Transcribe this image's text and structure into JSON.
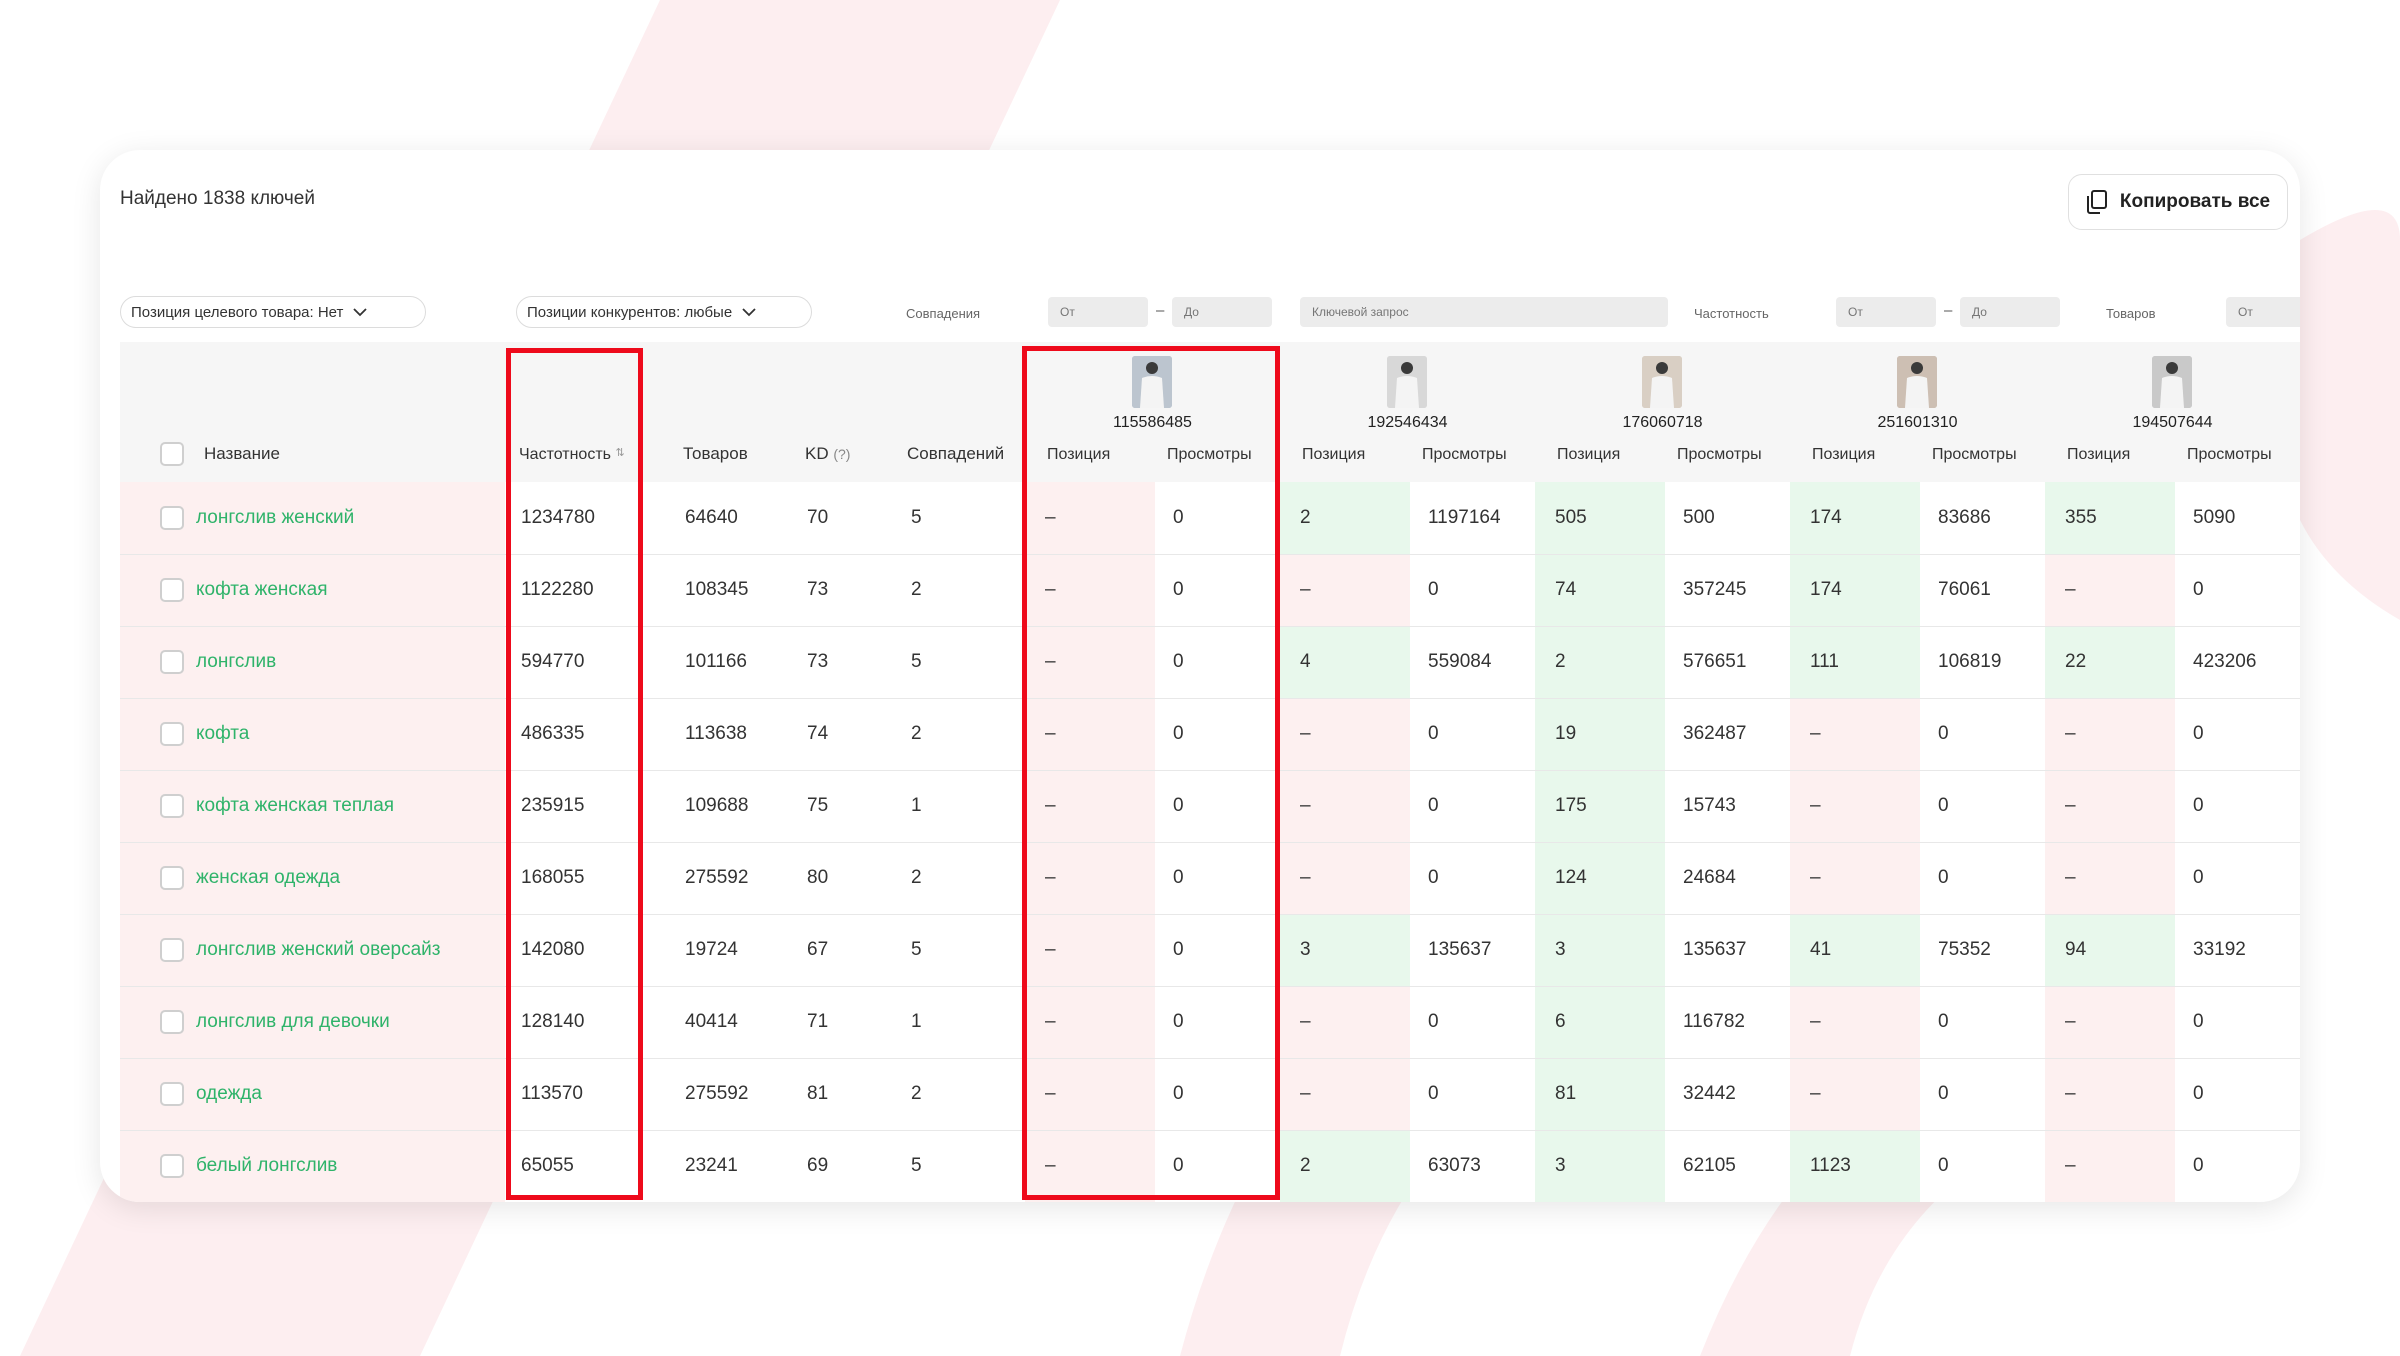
{
  "header": {
    "found_text": "Найдено 1838 ключей",
    "copy_all_label": "Копировать все"
  },
  "filters": {
    "target_position_label": "Позиция целевого товара: Нет",
    "competitor_position_label": "Позиции конкурентов: любые",
    "matches_label": "Совпадения",
    "frequency_label": "Частотность",
    "goods_label": "Товаров",
    "from_placeholder": "От",
    "to_placeholder": "До",
    "dash": "–",
    "keyword_placeholder": "Ключевой запрос"
  },
  "columns": {
    "name": "Название",
    "frequency": "Частотность",
    "goods": "Товаров",
    "kd": "KD",
    "kd_help": "(?)",
    "matches": "Совпадений",
    "position": "Позиция",
    "views": "Просмотры"
  },
  "products": [
    {
      "id": "115586485",
      "image_color": "#bcc5cf"
    },
    {
      "id": "192546434",
      "image_color": "#d8d8d8"
    },
    {
      "id": "176060718",
      "image_color": "#d9cfc4"
    },
    {
      "id": "251601310",
      "image_color": "#cdbfb3"
    },
    {
      "id": "194507644",
      "image_color": "#c9c9c9"
    }
  ],
  "colors": {
    "keyword": "#2fb36a",
    "highlight_box": "#ee0a1b",
    "absent_cell": "#fdf0f0",
    "present_cell": "#e8f8ec"
  },
  "rows": [
    {
      "name": "лонгслив женский",
      "frequency": "1234780",
      "goods": "64640",
      "kd": "70",
      "matches": "5",
      "comp": [
        [
          "–",
          "0"
        ],
        [
          "2",
          "1197164"
        ],
        [
          "505",
          "500"
        ],
        [
          "174",
          "83686"
        ],
        [
          "355",
          "5090"
        ]
      ]
    },
    {
      "name": "кофта женская",
      "frequency": "1122280",
      "goods": "108345",
      "kd": "73",
      "matches": "2",
      "comp": [
        [
          "–",
          "0"
        ],
        [
          "–",
          "0"
        ],
        [
          "74",
          "357245"
        ],
        [
          "174",
          "76061"
        ],
        [
          "–",
          "0"
        ]
      ]
    },
    {
      "name": "лонгслив",
      "frequency": "594770",
      "goods": "101166",
      "kd": "73",
      "matches": "5",
      "comp": [
        [
          "–",
          "0"
        ],
        [
          "4",
          "559084"
        ],
        [
          "2",
          "576651"
        ],
        [
          "111",
          "106819"
        ],
        [
          "22",
          "423206"
        ]
      ]
    },
    {
      "name": "кофта",
      "frequency": "486335",
      "goods": "113638",
      "kd": "74",
      "matches": "2",
      "comp": [
        [
          "–",
          "0"
        ],
        [
          "–",
          "0"
        ],
        [
          "19",
          "362487"
        ],
        [
          "–",
          "0"
        ],
        [
          "–",
          "0"
        ]
      ]
    },
    {
      "name": "кофта женская теплая",
      "frequency": "235915",
      "goods": "109688",
      "kd": "75",
      "matches": "1",
      "comp": [
        [
          "–",
          "0"
        ],
        [
          "–",
          "0"
        ],
        [
          "175",
          "15743"
        ],
        [
          "–",
          "0"
        ],
        [
          "–",
          "0"
        ]
      ]
    },
    {
      "name": "женская одежда",
      "frequency": "168055",
      "goods": "275592",
      "kd": "80",
      "matches": "2",
      "comp": [
        [
          "–",
          "0"
        ],
        [
          "–",
          "0"
        ],
        [
          "124",
          "24684"
        ],
        [
          "–",
          "0"
        ],
        [
          "–",
          "0"
        ]
      ]
    },
    {
      "name": "лонгслив женский оверсайз",
      "frequency": "142080",
      "goods": "19724",
      "kd": "67",
      "matches": "5",
      "comp": [
        [
          "–",
          "0"
        ],
        [
          "3",
          "135637"
        ],
        [
          "3",
          "135637"
        ],
        [
          "41",
          "75352"
        ],
        [
          "94",
          "33192"
        ]
      ]
    },
    {
      "name": "лонгслив для девочки",
      "frequency": "128140",
      "goods": "40414",
      "kd": "71",
      "matches": "1",
      "comp": [
        [
          "–",
          "0"
        ],
        [
          "–",
          "0"
        ],
        [
          "6",
          "116782"
        ],
        [
          "–",
          "0"
        ],
        [
          "–",
          "0"
        ]
      ]
    },
    {
      "name": "одежда",
      "frequency": "113570",
      "goods": "275592",
      "kd": "81",
      "matches": "2",
      "comp": [
        [
          "–",
          "0"
        ],
        [
          "–",
          "0"
        ],
        [
          "81",
          "32442"
        ],
        [
          "–",
          "0"
        ],
        [
          "–",
          "0"
        ]
      ]
    },
    {
      "name": "белый лонгслив",
      "frequency": "65055",
      "goods": "23241",
      "kd": "69",
      "matches": "5",
      "comp": [
        [
          "–",
          "0"
        ],
        [
          "2",
          "63073"
        ],
        [
          "3",
          "62105"
        ],
        [
          "1123",
          "0"
        ],
        [
          "–",
          "0"
        ]
      ]
    }
  ]
}
